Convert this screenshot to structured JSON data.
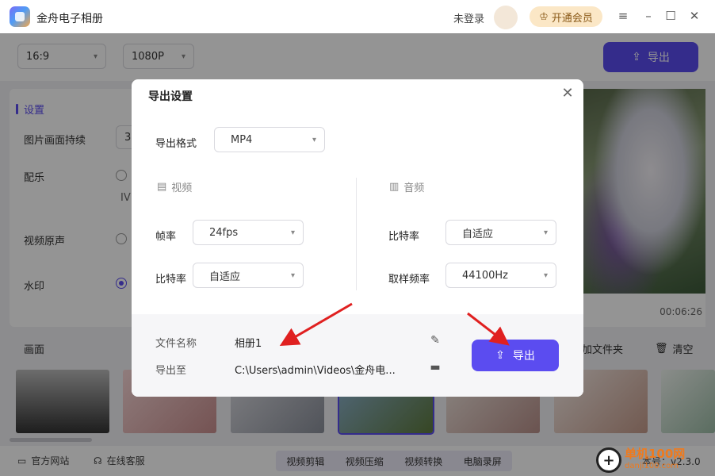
{
  "app": {
    "title": "金舟电子相册",
    "login_status": "未登录",
    "vip_label": "开通会员"
  },
  "toolbar": {
    "ratio": "16:9",
    "resolution": "1080P",
    "export_label": "导出"
  },
  "settings": {
    "title": "设置",
    "rows": [
      "图片画面持续",
      "配乐",
      "视频原声",
      "水印"
    ],
    "duration_value": "3",
    "music_partial": "IV"
  },
  "preview": {
    "time": "00:06:26"
  },
  "strip": {
    "label": "画面",
    "add_folder": "加文件夹",
    "clear": "清空"
  },
  "statusbar": {
    "website": "官方网站",
    "service": "在线客服",
    "tools": [
      "视频剪辑",
      "视频压缩",
      "视频转换",
      "电脑录屏"
    ],
    "version": "本号：v2.3.0"
  },
  "watermark": {
    "site": "单机100网",
    "url": "danji100.com"
  },
  "dialog": {
    "title": "导出设置",
    "format_label": "导出格式",
    "format_value": "MP4",
    "video_section": "视频",
    "audio_section": "音频",
    "framerate_label": "帧率",
    "framerate_value": "24fps",
    "video_bitrate_label": "比特率",
    "video_bitrate_value": "自适应",
    "audio_bitrate_label": "比特率",
    "audio_bitrate_value": "自适应",
    "samplerate_label": "取样频率",
    "samplerate_value": "44100Hz",
    "filename_label": "文件名称",
    "filename_value": "相册1",
    "exportto_label": "导出至",
    "exportto_value": "C:\\Users\\admin\\Videos\\金舟电...",
    "export_button": "导出"
  },
  "colors": {
    "accent": "#5b4cf0",
    "annotation_arrow": "#e02020"
  }
}
